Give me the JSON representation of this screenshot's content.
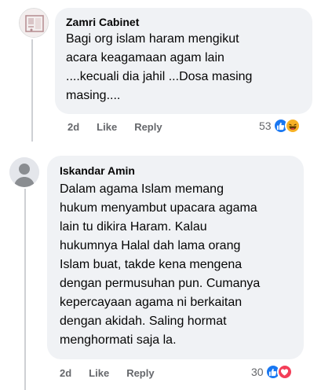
{
  "comments": [
    {
      "author": "Zamri Cabinet",
      "text": "Bagi org islam haram mengikut\nacara keagamaan agam lain\n....kecuali dia jahil ...Dosa masing\nmasing....",
      "time": "2d",
      "like_label": "Like",
      "reply_label": "Reply",
      "reaction_count": "53",
      "reactions": [
        "like-icon",
        "haha-icon"
      ]
    },
    {
      "author": "Iskandar Amin",
      "text": "Dalam agama Islam memang\nhukum menyambut upacara agama\nlain tu dikira Haram. Kalau\nhukumnya Halal dah lama orang\nIslam buat, takde kena mengena\ndengan permusuhan pun. Cumanya\nkepercayaan agama ni berkaitan\ndengan akidah. Saling hormat\nmenghormati saja la.",
      "time": "2d",
      "like_label": "Like",
      "reply_label": "Reply",
      "reaction_count": "30",
      "reactions": [
        "like-icon",
        "love-icon"
      ]
    }
  ],
  "colors": {
    "bubble": "#f0f2f5",
    "meta": "#65676b",
    "like_blue": "#1877f2",
    "love_red": "#f33e58",
    "haha_yellow": "#f7b125"
  }
}
